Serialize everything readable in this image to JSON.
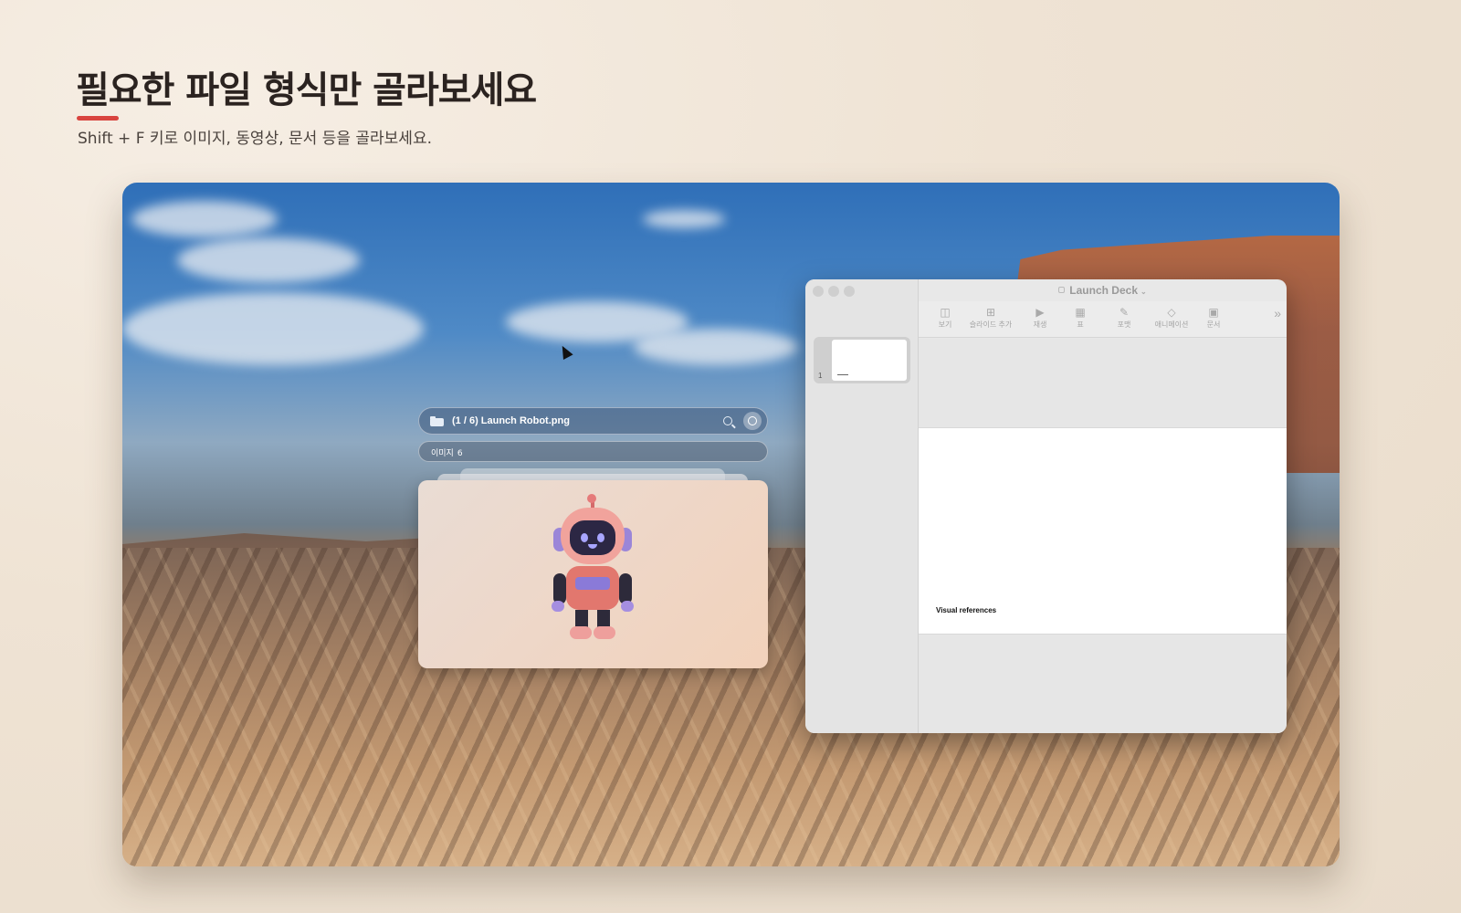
{
  "header": {
    "title": "필요한 파일 형식만 골라보세요",
    "subtitle": "Shift + F 키로 이미지, 동영상, 문서 등을 골라보세요."
  },
  "search_panel": {
    "title": "(1 / 6) Launch Robot.png",
    "filter_chip": {
      "label": "이미지",
      "count": "6"
    },
    "icons": [
      "folder-icon",
      "search-icon",
      "filter-icon"
    ]
  },
  "keynote": {
    "window_title": "Launch Deck",
    "toolbar": [
      {
        "label": "보기",
        "icon": "view-icon"
      },
      {
        "label": "슬라이드 추가",
        "icon": "add-slide-icon"
      },
      {
        "label": "재생",
        "icon": "play-icon"
      },
      {
        "label": "표",
        "icon": "table-icon"
      },
      {
        "label": "포맷",
        "icon": "format-icon"
      },
      {
        "label": "애니메이션",
        "icon": "animate-icon"
      },
      {
        "label": "문서",
        "icon": "document-icon"
      }
    ],
    "slide_number": "1",
    "slide_text": "Visual references"
  },
  "colors": {
    "accent": "#d9443f",
    "heading": "#2b2320"
  }
}
